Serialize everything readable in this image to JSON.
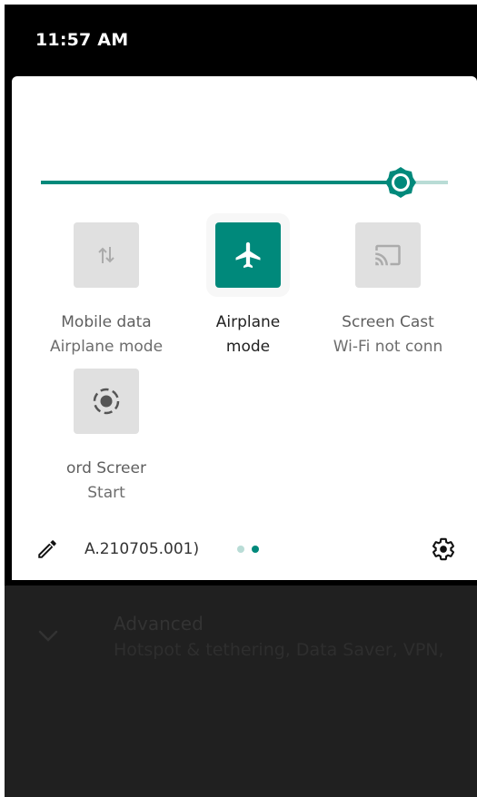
{
  "status_bar": {
    "time": "11:57 AM"
  },
  "brightness": {
    "level": 0.885
  },
  "tiles": [
    {
      "id": "mobile-data",
      "label": "Mobile data",
      "sub": "Airplane mode",
      "active": false
    },
    {
      "id": "airplane-mode",
      "label": "Airplane",
      "sub": "mode",
      "active": true
    },
    {
      "id": "screen-cast",
      "label": "Screen Cast",
      "sub": "Wi-Fi not conn",
      "active": false
    },
    {
      "id": "screen-record",
      "label": "ord     Screer",
      "sub": "Start",
      "active": false
    }
  ],
  "footer": {
    "build_number": "A.210705.001)",
    "pages": 2,
    "current_page": 2
  },
  "underlay": {
    "title": "Advanced",
    "summary": "Hotspot & tethering, Data Saver, VPN,"
  },
  "colors": {
    "accent": "#00897b",
    "accent_light": "#b9dcd6",
    "tile_inactive": "#e0e0e0",
    "icon_inactive": "#9e9e9e"
  }
}
